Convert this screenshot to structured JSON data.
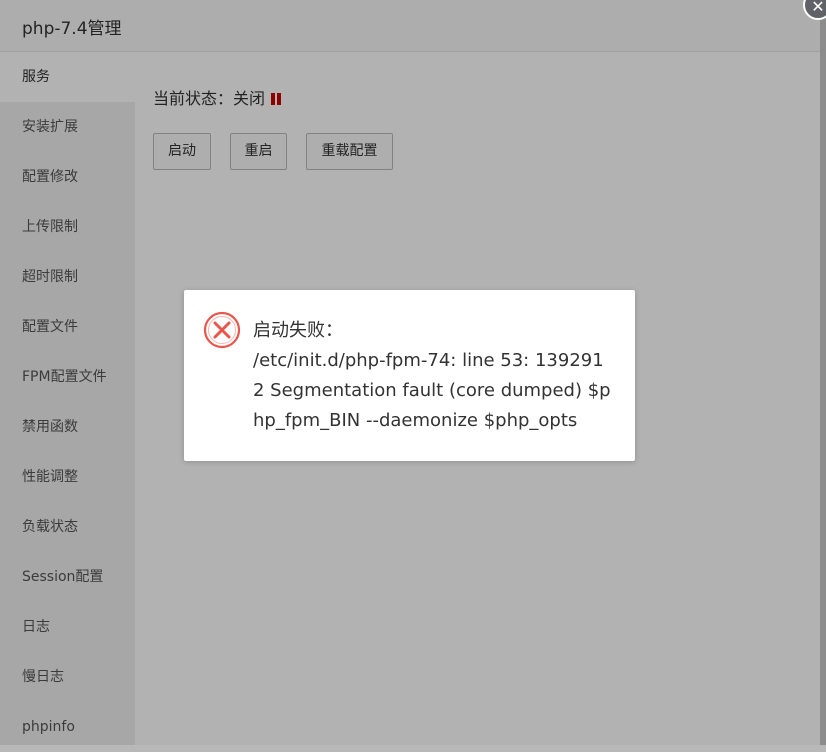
{
  "window": {
    "title": "php-7.4管理"
  },
  "sidebar": {
    "items": [
      {
        "label": "服务"
      },
      {
        "label": "安装扩展"
      },
      {
        "label": "配置修改"
      },
      {
        "label": "上传限制"
      },
      {
        "label": "超时限制"
      },
      {
        "label": "配置文件"
      },
      {
        "label": "FPM配置文件"
      },
      {
        "label": "禁用函数"
      },
      {
        "label": "性能调整"
      },
      {
        "label": "负载状态"
      },
      {
        "label": "Session配置"
      },
      {
        "label": "日志"
      },
      {
        "label": "慢日志"
      },
      {
        "label": "phpinfo"
      }
    ],
    "active_index": 0
  },
  "service": {
    "status_label": "当前状态：",
    "status_value": "关闭",
    "status_icon": "pause-icon",
    "status_color": "#cc0000",
    "buttons": {
      "start": "启动",
      "restart": "重启",
      "reload": "重载配置"
    }
  },
  "dialog": {
    "icon": "error-circle-icon",
    "icon_color": "#e9564b",
    "title": "启动失败：",
    "message": "/etc/init.d/php-fpm-74: line 53: 1392912 Segmentation fault (core dumped) $php_fpm_BIN --daemonize $php_opts"
  },
  "close_icon": "close-icon"
}
